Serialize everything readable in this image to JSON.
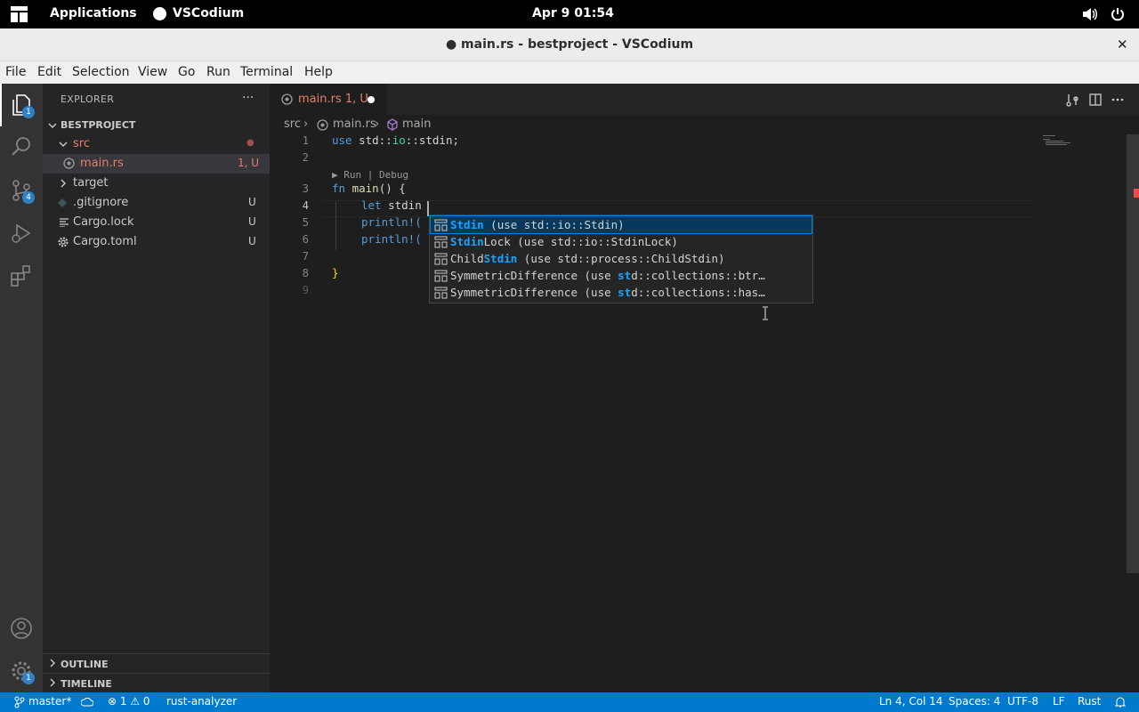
{
  "topbar": {
    "applications": "Applications",
    "app_name": "VSCodium",
    "clock": "Apr 9  01:54"
  },
  "window": {
    "title": "● main.rs - bestproject - VSCodium",
    "close": "✕"
  },
  "menu": [
    "File",
    "Edit",
    "Selection",
    "View",
    "Go",
    "Run",
    "Terminal",
    "Help"
  ],
  "activity": {
    "explorer_badge": "1",
    "scm_badge": "4",
    "settings_badge": "1"
  },
  "sidebar": {
    "header": "EXPLORER",
    "more": "···",
    "project": "BESTPROJECT",
    "tree": [
      {
        "label": "src",
        "status": "●"
      },
      {
        "label": "main.rs",
        "status": "1, U"
      },
      {
        "label": "target",
        "status": ""
      },
      {
        "label": ".gitignore",
        "status": "U"
      },
      {
        "label": "Cargo.lock",
        "status": "U"
      },
      {
        "label": "Cargo.toml",
        "status": "U"
      }
    ],
    "outline": "OUTLINE",
    "timeline": "TIMELINE"
  },
  "tab": {
    "label": "main.rs 1, U"
  },
  "breadcrumbs": {
    "folder": "src",
    "file": "main.rs",
    "symbol": "main"
  },
  "editor": {
    "line_numbers": [
      "1",
      "2",
      "3",
      "4",
      "5",
      "6",
      "7",
      "8",
      "9"
    ],
    "codelens": "▶ Run | Debug",
    "lines": {
      "l1_kw": "use",
      "l1_rest_a": " std::",
      "l1_ns": "io",
      "l1_rest_b": "::stdin;",
      "l3_kw": "fn",
      "l3_fn": " main",
      "l3_rest": "() {",
      "l4_kw": "let",
      "l4_rest": " stdin",
      "l5": "println!(",
      "l6": "println!(",
      "l8": "}"
    }
  },
  "suggest": [
    {
      "hl": "Stdin",
      "rest": " (use std::io::Stdin)",
      "pre": ""
    },
    {
      "hl": "Stdin",
      "rest": "Lock (use std::io::StdinLock)",
      "pre": ""
    },
    {
      "pre": "Child",
      "hl": "Stdin",
      "rest": " (use std::process::ChildStdin)"
    },
    {
      "pre": "SymmetricDifference (use ",
      "hl": "st",
      "rest": "d::collections::btr…"
    },
    {
      "pre": "SymmetricDifference (use ",
      "hl": "st",
      "rest": "d::collections::has…"
    }
  ],
  "status": {
    "branch": "master*",
    "problems": "⊗ 1 ⚠ 0",
    "server": "rust-analyzer",
    "position": "Ln 4, Col 14",
    "spaces": "Spaces: 4",
    "encoding": "UTF-8",
    "eol": "LF",
    "language": "Rust"
  },
  "colors": {
    "accent": "#007acc",
    "modified": "#e2806a",
    "highlight": "#18a3ff"
  }
}
